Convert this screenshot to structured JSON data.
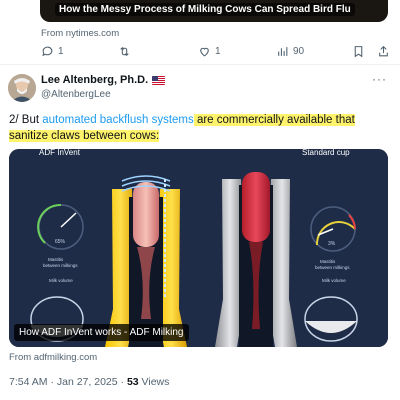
{
  "previous_post": {
    "card_headline": "How the Messy Process of Milking Cows Can Spread Bird Flu",
    "source": "From nytimes.com",
    "actions": {
      "replies": "1",
      "reposts": "",
      "likes": "1",
      "views": "90"
    }
  },
  "post": {
    "author_name": "Lee Altenberg, Ph.D.",
    "author_handle": "@AltenbergLee",
    "author_flag": "us-flag-icon",
    "more_label": "···",
    "text_prefix": "2/ But ",
    "link_text": "automated backflush systems",
    "text_mid": " are commercially available that",
    "text_line2": "sanitize claws between cows:",
    "media": {
      "left_label": "ADF InVent",
      "right_label": "Standard cup",
      "left_caption_line1": "Mastitis",
      "left_caption_line2": "between milkings",
      "right_caption_line1": "Mastitis",
      "right_caption_line2": "between milkings",
      "left_jar_label": "Milk volume",
      "right_jar_label": "Milk volume",
      "gauge_left_value": "65%",
      "gauge_right_value": "3%",
      "video_title": "How ADF InVent works - ADF Milking"
    },
    "media_source": "From adfmilking.com",
    "time": "7:54 AM",
    "date": "Jan 27, 2025",
    "separator": "·",
    "views_count": "53",
    "views_label": "Views"
  },
  "colors": {
    "text_primary": "#0f1419",
    "text_secondary": "#536471",
    "link": "#1d9bf0",
    "highlight": "#fff36b",
    "media_bg": "#1e2c47"
  }
}
